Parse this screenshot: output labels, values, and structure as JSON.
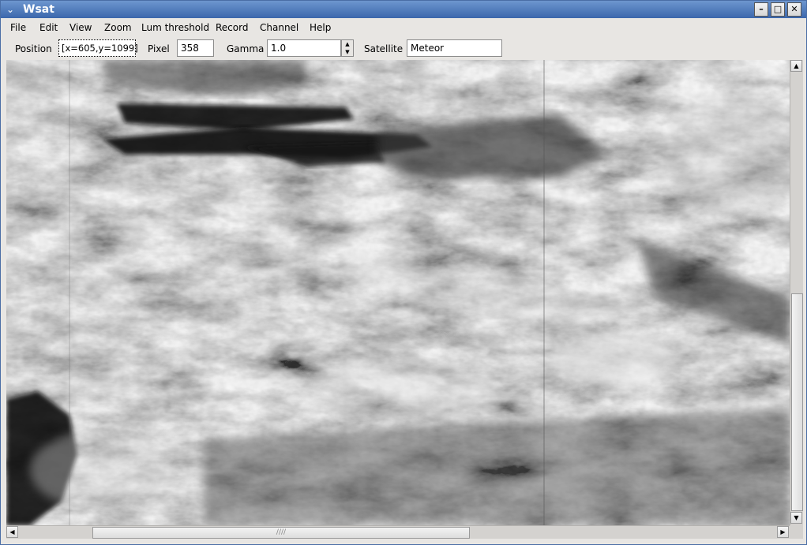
{
  "window": {
    "title": "Wsat",
    "menu_glyph": "⌄",
    "minimize_glyph": "–",
    "maximize_glyph": "□",
    "close_glyph": "✕"
  },
  "menubar": {
    "items": [
      "File",
      "Edit",
      "View",
      "Zoom",
      "Lum threshold",
      "Record",
      "Channel",
      "Help"
    ]
  },
  "toolbar": {
    "position_label": "Position",
    "position_value": "[x=605,y=1099]",
    "pixel_label": "Pixel",
    "pixel_value": "358",
    "gamma_label": "Gamma",
    "gamma_value": "1.0",
    "satellite_label": "Satellite",
    "satellite_value": "Meteor"
  },
  "scrollbars": {
    "up_glyph": "▲",
    "down_glyph": "▼",
    "left_glyph": "◀",
    "right_glyph": "▶",
    "grip_glyph": "////",
    "vertical_position": 0.72,
    "horizontal_position": 0.12
  },
  "colors": {
    "titlebar_top": "#6d96cf",
    "titlebar_bottom": "#3b67ac",
    "window_bg": "#e8e6e3"
  },
  "icons": {
    "window_menu": "chevron-down-icon",
    "minimize": "minimize-icon",
    "maximize": "maximize-icon",
    "close": "close-icon"
  }
}
